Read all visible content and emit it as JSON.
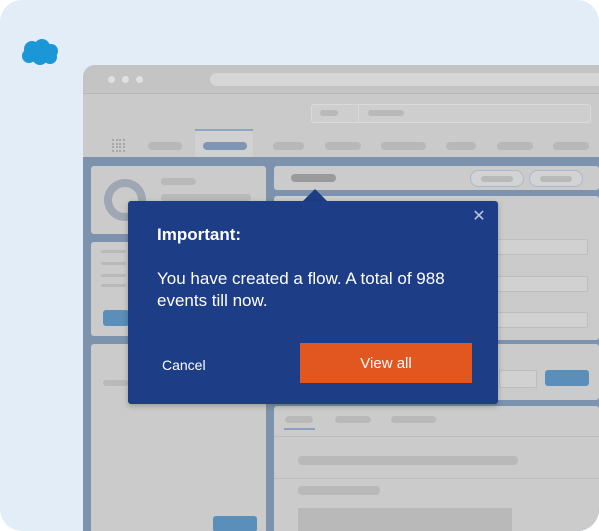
{
  "popover": {
    "heading": "Important:",
    "message": "You have created a flow. A total of 988  events till now.",
    "cancel_label": "Cancel",
    "view_all_label": "View all",
    "close_icon": "close-icon"
  },
  "colors": {
    "popover_bg": "#1d3d86",
    "primary_button": "#e2561f",
    "background": "#e2edf8",
    "logo": "#1b96d6"
  },
  "icons": [
    "cloud-logo-icon",
    "app-launcher-icon",
    "close-icon"
  ]
}
